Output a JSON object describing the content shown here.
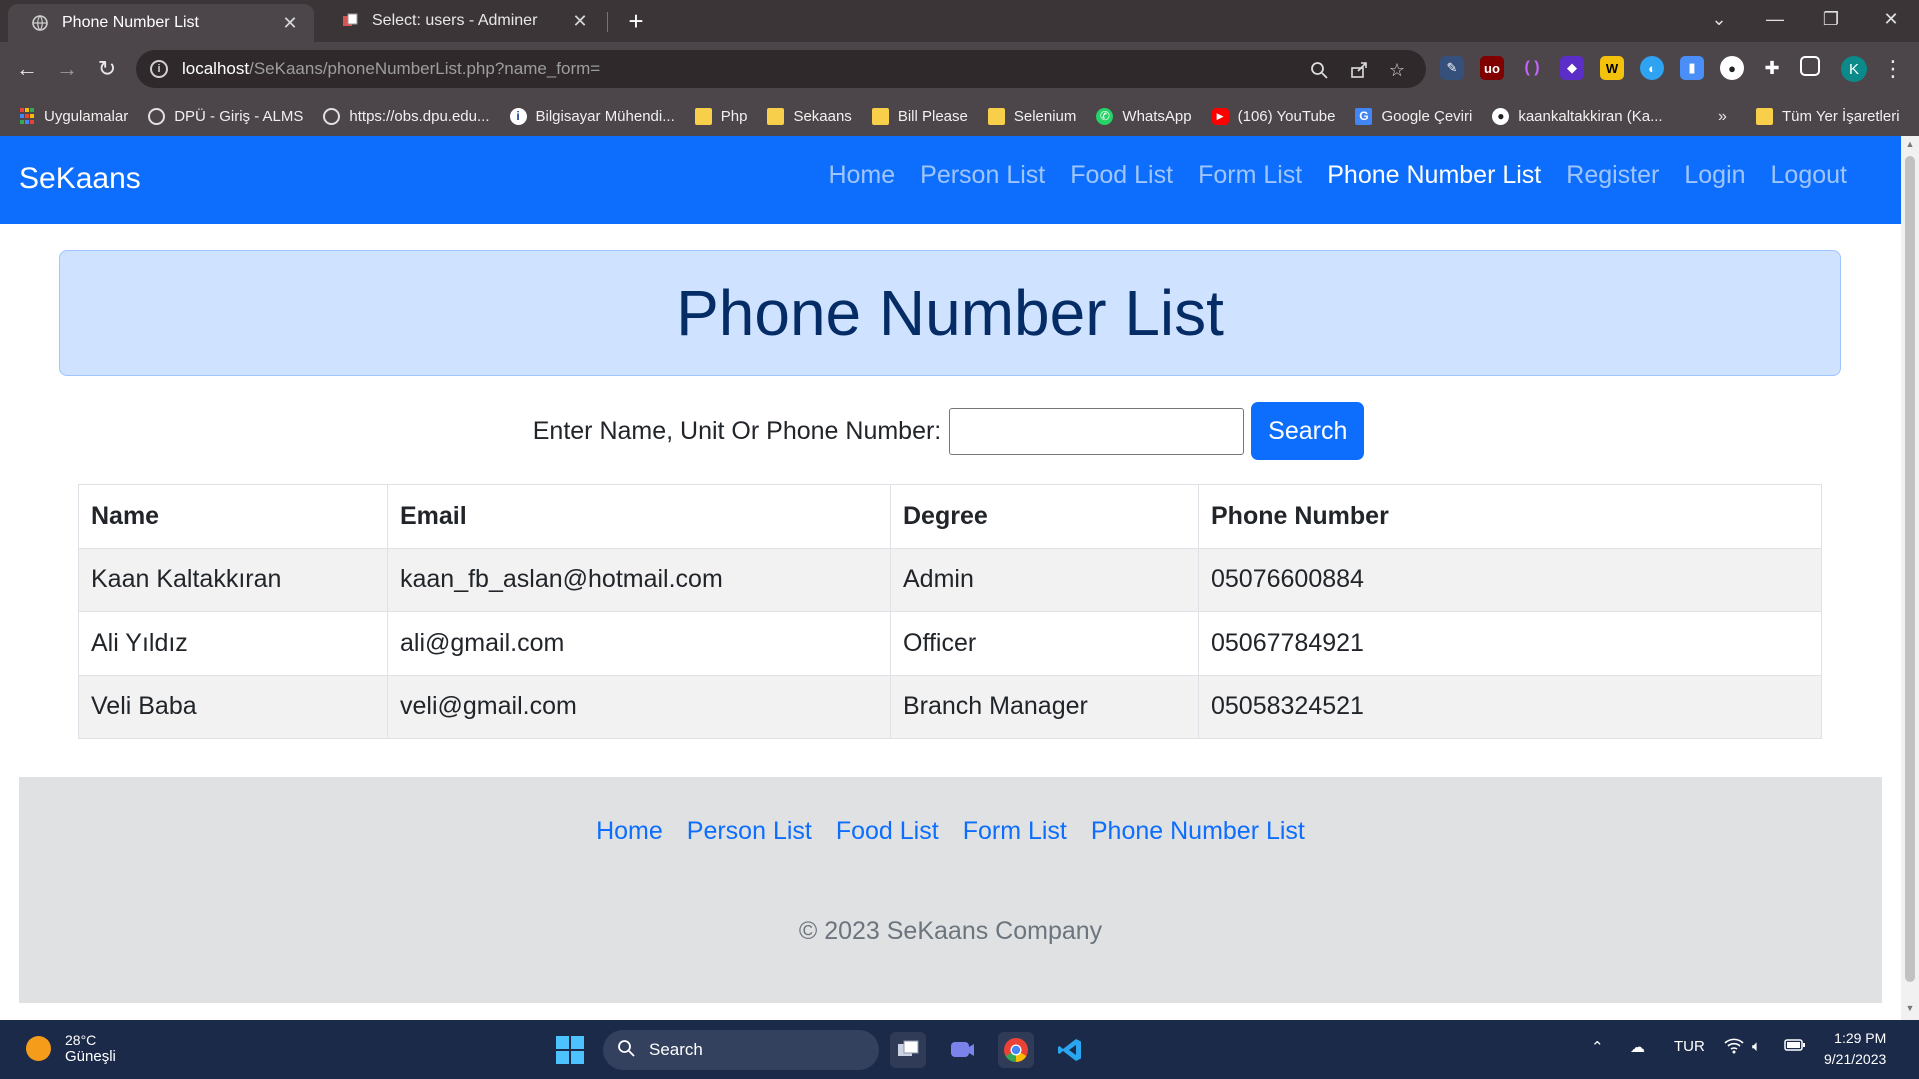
{
  "browser": {
    "tabs": [
      {
        "title": "Phone Number List",
        "active": true
      },
      {
        "title": "Select: users - Adminer",
        "active": false
      }
    ],
    "url_host": "localhost",
    "url_path": "/SeKaans/phoneNumberList.php?name_form=",
    "profile_initial": "K",
    "bookmarks": [
      {
        "label": "Uygulamalar",
        "icon": "apps-icon"
      },
      {
        "label": "DPÜ - Giriş - ALMS",
        "icon": "globe-icon"
      },
      {
        "label": "https://obs.dpu.edu...",
        "icon": "globe-icon"
      },
      {
        "label": "Bilgisayar Mühendi...",
        "icon": "site-icon"
      },
      {
        "label": "Php",
        "icon": "folder-icon"
      },
      {
        "label": "Sekaans",
        "icon": "folder-icon"
      },
      {
        "label": "Bill Please",
        "icon": "folder-icon"
      },
      {
        "label": "Selenium",
        "icon": "folder-icon"
      },
      {
        "label": "WhatsApp",
        "icon": "whatsapp-icon"
      },
      {
        "label": "(106) YouTube",
        "icon": "youtube-icon"
      },
      {
        "label": "Google Çeviri",
        "icon": "translate-icon"
      },
      {
        "label": "kaankaltakkiran (Ka...",
        "icon": "github-icon"
      }
    ],
    "bookmarks_more": "»",
    "all_bookmarks": "Tüm Yer İşaretleri"
  },
  "site": {
    "brand": "SeKaans",
    "nav": [
      "Home",
      "Person List",
      "Food List",
      "Form List",
      "Phone Number List",
      "Register",
      "Login",
      "Logout"
    ],
    "active_nav": "Phone Number List",
    "heading": "Phone Number List",
    "search": {
      "label": "Enter Name, Unit Or Phone Number:",
      "value": "",
      "button": "Search"
    },
    "table": {
      "headers": [
        "Name",
        "Email",
        "Degree",
        "Phone Number"
      ],
      "rows": [
        [
          "Kaan Kaltakkıran",
          "kaan_fb_aslan@hotmail.com",
          "Admin",
          "05076600884"
        ],
        [
          "Ali Yıldız",
          "ali@gmail.com",
          "Officer",
          "05067784921"
        ],
        [
          "Veli Baba",
          "veli@gmail.com",
          "Branch Manager",
          "05058324521"
        ]
      ]
    },
    "footer": {
      "links": [
        "Home",
        "Person List",
        "Food List",
        "Form List",
        "Phone Number List"
      ],
      "copyright": "© 2023 SeKaans Company"
    }
  },
  "taskbar": {
    "temperature": "28°C",
    "weather": "Güneşli",
    "search_label": "Search",
    "language": "TUR",
    "time": "1:29 PM",
    "date": "9/21/2023"
  },
  "colors": {
    "primary": "#0d6efd",
    "header_bg": "#cfe2ff",
    "header_text": "#052c65",
    "footer_bg": "#e0e1e3"
  }
}
